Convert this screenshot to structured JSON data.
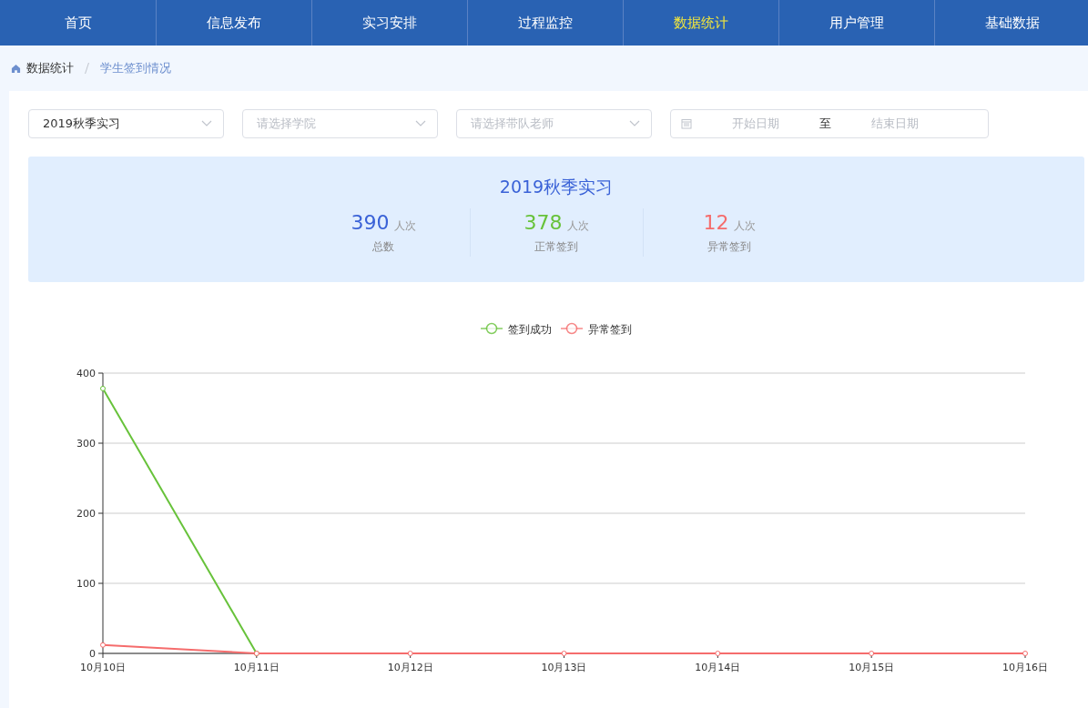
{
  "nav": {
    "tabs": [
      {
        "label": "首页",
        "selected": false
      },
      {
        "label": "信息发布",
        "selected": false
      },
      {
        "label": "实习安排",
        "selected": false
      },
      {
        "label": "过程监控",
        "selected": false
      },
      {
        "label": "数据统计",
        "selected": true
      },
      {
        "label": "用户管理",
        "selected": false
      },
      {
        "label": "基础数据",
        "selected": false
      }
    ]
  },
  "breadcrumb": [
    "数据统计",
    "学生签到情况"
  ],
  "filters": {
    "selects": [
      {
        "value": "2019秋季实习"
      },
      {
        "placeholder": "请选择学院"
      },
      {
        "placeholder": "请选择带队老师"
      }
    ],
    "date_range": {
      "start_placeholder": "开始日期",
      "separator": "至",
      "end_placeholder": "结束日期"
    }
  },
  "summary": {
    "title": "2019秋季实习",
    "stats": [
      {
        "value": "390",
        "unit": "人次",
        "label": "总数",
        "color": "#3a62d7"
      },
      {
        "value": "378",
        "unit": "人次",
        "label": "正常签到",
        "color": "#67c23a"
      },
      {
        "value": "12",
        "unit": "人次",
        "label": "异常签到",
        "color": "#f56c6c"
      }
    ]
  },
  "chart": {
    "chart_data": {
      "type": "line",
      "categories": [
        "10月10日",
        "10月11日",
        "10月12日",
        "10月13日",
        "10月14日",
        "10月15日",
        "10月16日"
      ],
      "series": [
        {
          "name": "签到成功",
          "color": "#67c23a",
          "marker": "circle",
          "values": [
            378,
            0,
            null,
            null,
            null,
            null,
            null
          ]
        },
        {
          "name": "异常签到",
          "color": "#f56c6c",
          "marker": "circle",
          "values": [
            12,
            0,
            0,
            0,
            0,
            0,
            0
          ]
        }
      ],
      "grid": true,
      "legend": true,
      "ylim": [
        0,
        400
      ],
      "yticks": [
        0,
        100,
        200,
        300,
        400
      ]
    }
  }
}
